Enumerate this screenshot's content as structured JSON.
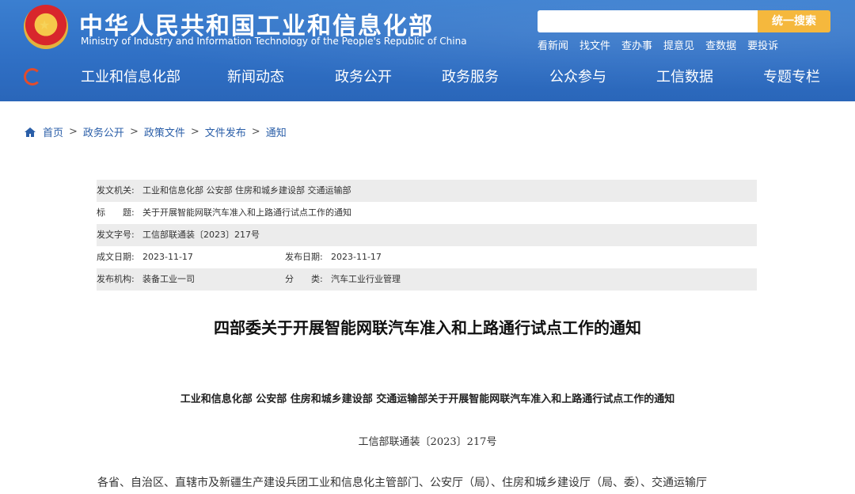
{
  "header": {
    "title": "中华人民共和国工业和信息化部",
    "subtitle": "Ministry of Industry and Information Technology of the People's Republic of China",
    "search_placeholder": "",
    "search_button": "统一搜索",
    "quick_links": [
      "看新闻",
      "找文件",
      "查办事",
      "提意见",
      "查数据",
      "要投诉"
    ]
  },
  "nav": {
    "items": [
      "工业和信息化部",
      "新闻动态",
      "政务公开",
      "政务服务",
      "公众参与",
      "工信数据",
      "专题专栏"
    ]
  },
  "breadcrumb": {
    "items": [
      "首页",
      "政务公开",
      "政策文件",
      "文件发布",
      "通知"
    ],
    "separator": ">"
  },
  "meta": {
    "issuer_label": "发文机关:",
    "issuer": "工业和信息化部 公安部 住房和城乡建设部 交通运输部",
    "title_label": "标　　题:",
    "title": "关于开展智能网联汽车准入和上路通行试点工作的通知",
    "docno_label": "发文字号:",
    "docno": "工信部联通装〔2023〕217号",
    "created_label": "成文日期:",
    "created": "2023-11-17",
    "published_label": "发布日期:",
    "published": "2023-11-17",
    "agency_label": "发布机构:",
    "agency": "装备工业一司",
    "category_label": "分　　类:",
    "category": "汽车工业行业管理"
  },
  "article": {
    "title": "四部委关于开展智能网联汽车准入和上路通行试点工作的通知",
    "heading": "工业和信息化部 公安部 住房和城乡建设部 交通运输部关于开展智能网联汽车准入和上路通行试点工作的通知",
    "doc_number": "工信部联通装〔2023〕217号",
    "body_first_line": "各省、自治区、直辖市及新疆生产建设兵团工业和信息化主管部门、公安厅（局）、住房和城乡建设厅（局、委）、交通运输厅"
  },
  "colors": {
    "header_blue": "#2f6fc4",
    "search_orange": "#f5b83d",
    "link_blue": "#2a5ea8",
    "row_shade": "#ececec"
  }
}
